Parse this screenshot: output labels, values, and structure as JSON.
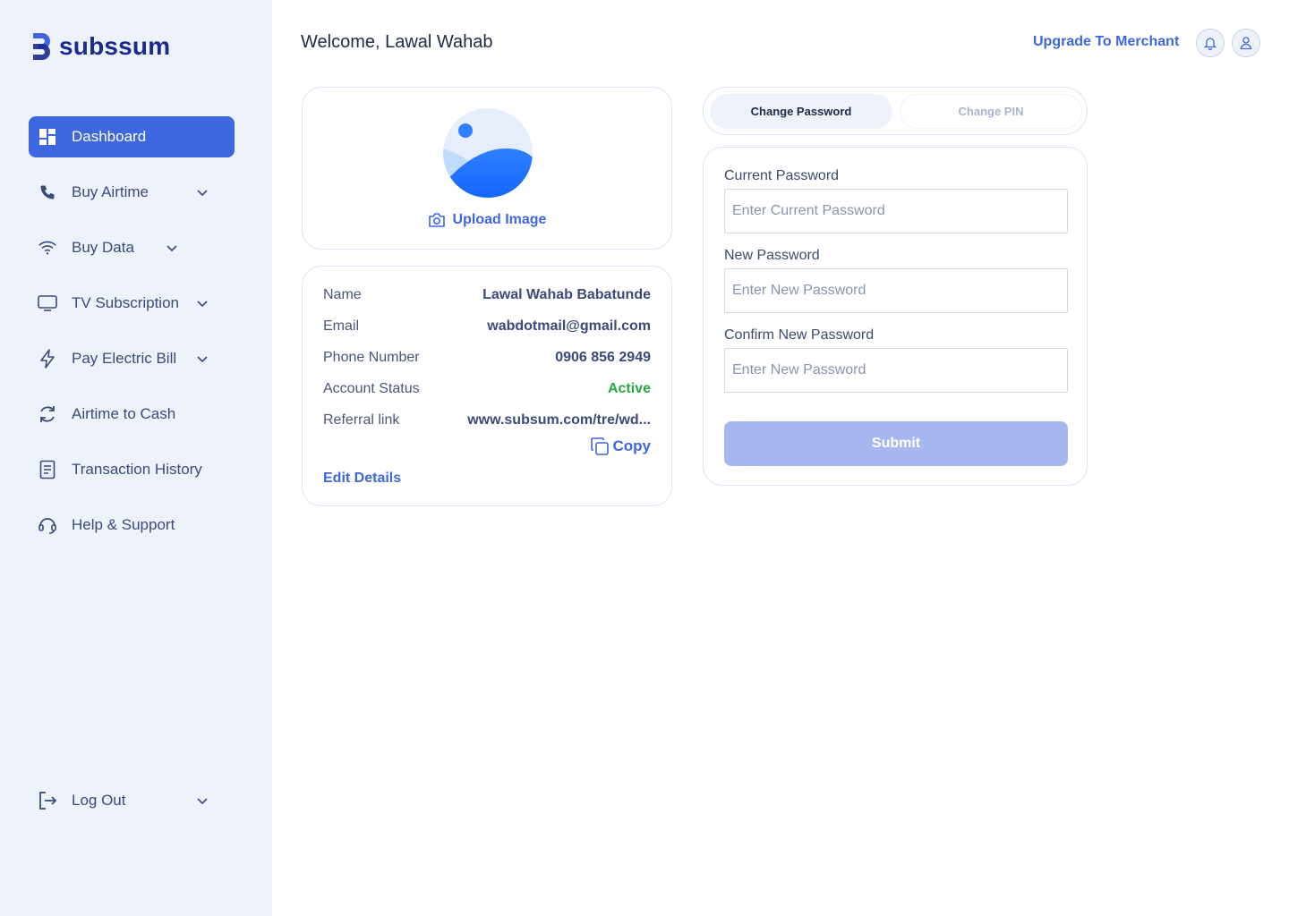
{
  "brand": {
    "name": "subssum"
  },
  "sidebar": {
    "items": [
      {
        "label": "Dashboard",
        "icon": "dashboard-icon",
        "active": true,
        "dropdown": false
      },
      {
        "label": "Buy Airtime",
        "icon": "phone-icon",
        "dropdown": true
      },
      {
        "label": "Buy Data",
        "icon": "wifi-icon",
        "dropdown": true
      },
      {
        "label": "TV Subscription",
        "icon": "tv-icon",
        "dropdown": true
      },
      {
        "label": "Pay Electric Bill",
        "icon": "bolt-icon",
        "dropdown": true
      },
      {
        "label": "Airtime to Cash",
        "icon": "refresh-icon",
        "dropdown": false
      },
      {
        "label": "Transaction History",
        "icon": "receipt-icon",
        "dropdown": false
      },
      {
        "label": "Help & Support",
        "icon": "headset-icon",
        "dropdown": false
      }
    ],
    "logout": {
      "label": "Log Out",
      "icon": "logout-icon"
    }
  },
  "header": {
    "welcome": "Welcome, Lawal Wahab",
    "upgrade_label": "Upgrade To Merchant",
    "notification_icon": "bell-icon",
    "profile_icon": "user-icon"
  },
  "profile": {
    "upload_label": "Upload Image",
    "details": [
      {
        "key": "Name",
        "value": "Lawal Wahab Babatunde"
      },
      {
        "key": "Email",
        "value": "wabdotmail@gmail.com"
      },
      {
        "key": "Phone Number",
        "value": "0906 856 2949"
      },
      {
        "key": "Account Status",
        "value": "Active"
      },
      {
        "key": "Referral link",
        "value": "www.subsum.com/tre/wd..."
      }
    ],
    "copy_label": "Copy",
    "edit_label": "Edit Details"
  },
  "security": {
    "tabs": [
      "Change Password",
      "Change PIN"
    ],
    "active_tab": "Change Password",
    "fields": [
      {
        "label": "Current Password",
        "value": "",
        "placeholder": "Enter Current Password"
      },
      {
        "label": "New Password",
        "value": "",
        "placeholder": "Enter New Password"
      },
      {
        "label": "Confirm New Password",
        "value": "",
        "placeholder": "Enter New Password"
      }
    ],
    "submit_label": "Submit"
  },
  "colors": {
    "accent": "#3e66df",
    "sidebar_bg": "#eef2fb",
    "status_active": "#27a844",
    "submit_disabled": "#a6b8ef",
    "brand_dark": "#1b2a8f"
  }
}
